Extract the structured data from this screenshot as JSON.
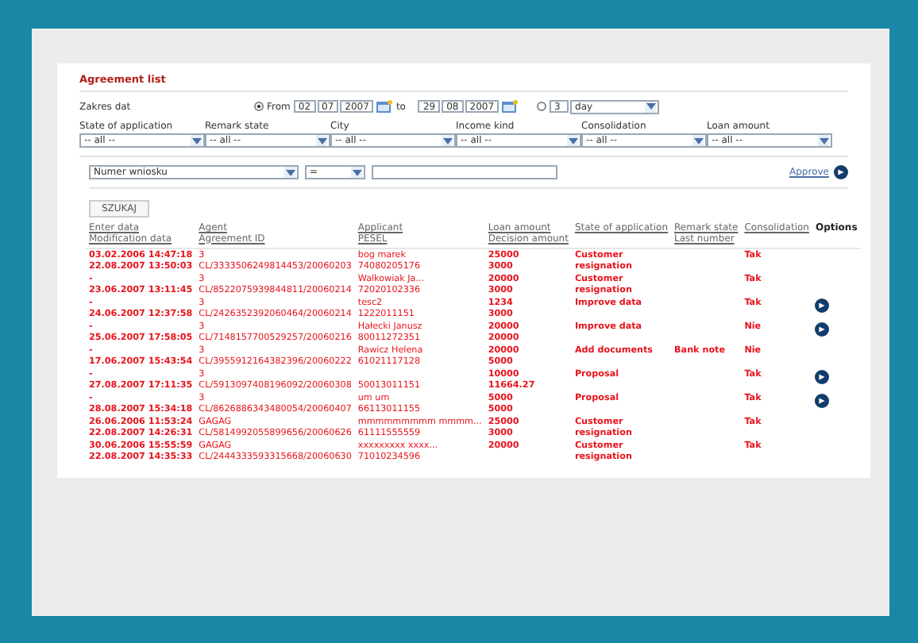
{
  "title": "Agreement list",
  "date_range": {
    "label": "Zakres dat",
    "from_option": {
      "label": "From",
      "selected": true
    },
    "from": [
      "02",
      "07",
      "2007"
    ],
    "to_label": "to",
    "to": [
      "29",
      "08",
      "2007"
    ],
    "last_option": {
      "selected": false
    },
    "last_count": "3",
    "last_unit": "day"
  },
  "filters": [
    {
      "label": "State of application",
      "value": "-- all --"
    },
    {
      "label": "Remark state",
      "value": "-- all --"
    },
    {
      "label": "City",
      "value": "-- all --"
    },
    {
      "label": "Income kind",
      "value": "-- all --"
    },
    {
      "label": "Consolidation",
      "value": "-- all --"
    },
    {
      "label": "Loan amount",
      "value": "-- all --"
    }
  ],
  "search": {
    "field": "Numer wniosku",
    "operator": "=",
    "approve_link": "Approve"
  },
  "search_button": "SZUKAJ",
  "table": {
    "columns": [
      [
        "Enter data",
        "Modification data"
      ],
      [
        "Agent",
        "Agreement ID"
      ],
      [
        "Applicant",
        "PESEL"
      ],
      [
        "Loan amount",
        "Decision amount"
      ],
      [
        "State of application"
      ],
      [
        "Remark state",
        "Last number"
      ],
      [
        "Consolidation"
      ],
      [
        "Options"
      ]
    ],
    "rows": [
      {
        "entered": "03.02.2006 14:47:18",
        "modified": "22.08.2007 13:50:03",
        "agent": "3",
        "agreement_id": "CL/3333506249814453/20060203",
        "applicant": "bog marek",
        "pesel": "74080205176",
        "loan": "25000",
        "decision": "3000",
        "state": "Customer resignation",
        "consolidation": "Tak",
        "action": false
      },
      {
        "entered": "-",
        "modified": "23.06.2007 13:11:45",
        "agent": "3",
        "agreement_id": "CL/8522075939844811/20060214",
        "applicant": "Walkowiak Ja...",
        "pesel": "72020102336",
        "loan": "20000",
        "decision": "3000",
        "state": "Customer resignation",
        "consolidation": "Tak",
        "action": false
      },
      {
        "entered": "-",
        "modified": "24.06.2007 12:37:58",
        "agent": "3",
        "agreement_id": "CL/2426352392060464/20060214",
        "applicant": "tesc2",
        "pesel": "1222011151",
        "loan": "1234",
        "decision": "3000",
        "state": "Improve data",
        "consolidation": "Tak",
        "action": true
      },
      {
        "entered": "-",
        "modified": "25.06.2007 17:58:05",
        "agent": "3",
        "agreement_id": "CL/7148157700529257/20060216",
        "applicant": "Hałecki Janusz",
        "pesel": "80011272351",
        "loan": "20000",
        "decision": "20000",
        "state": "Improve data",
        "consolidation": "Nie",
        "action": true
      },
      {
        "entered": "-",
        "modified": "17.06.2007 15:43:54",
        "agent": "3",
        "agreement_id": "CL/3955912164382396/20060222",
        "applicant": "Rawicz Helena",
        "pesel": "61021117128",
        "loan": "20000",
        "decision": "5000",
        "state": "Add documents",
        "remark": "Bank note",
        "consolidation": "Nie",
        "action": false
      },
      {
        "entered": "-",
        "modified": "27.08.2007 17:11:35",
        "agent": "3",
        "agreement_id": "CL/5913097408196092/20060308",
        "pesel": "50013011151",
        "loan": "10000",
        "decision": "11664.27",
        "state": "Proposal",
        "consolidation": "Tak",
        "action": true
      },
      {
        "entered": "-",
        "modified": "28.08.2007 15:34:18",
        "agent": "3",
        "agreement_id": "CL/8626886343480054/20060407",
        "applicant": "um um",
        "pesel": "66113011155",
        "loan": "5000",
        "decision": "5000",
        "state": "Proposal",
        "consolidation": "Tak",
        "action": true
      },
      {
        "entered": "26.06.2006 11:53:24",
        "modified": "22.08.2007 14:26:31",
        "agent": "GAGAG",
        "agreement_id": "CL/5814992055899656/20060626",
        "applicant": "mmmmmmmmm mmmm...",
        "pesel": "61111555559",
        "loan": "25000",
        "decision": "3000",
        "state": "Customer resignation",
        "consolidation": "Tak",
        "action": false
      },
      {
        "entered": "30.06.2006 15:55:59",
        "modified": "22.08.2007 14:35:33",
        "agent": "GAGAG",
        "agreement_id": "CL/2444333593315668/20060630",
        "applicant": "xxxxxxxxx xxxx...",
        "pesel": "71010234596",
        "loan": "20000",
        "state": "Customer resignation",
        "consolidation": "Tak",
        "action": false
      }
    ]
  }
}
